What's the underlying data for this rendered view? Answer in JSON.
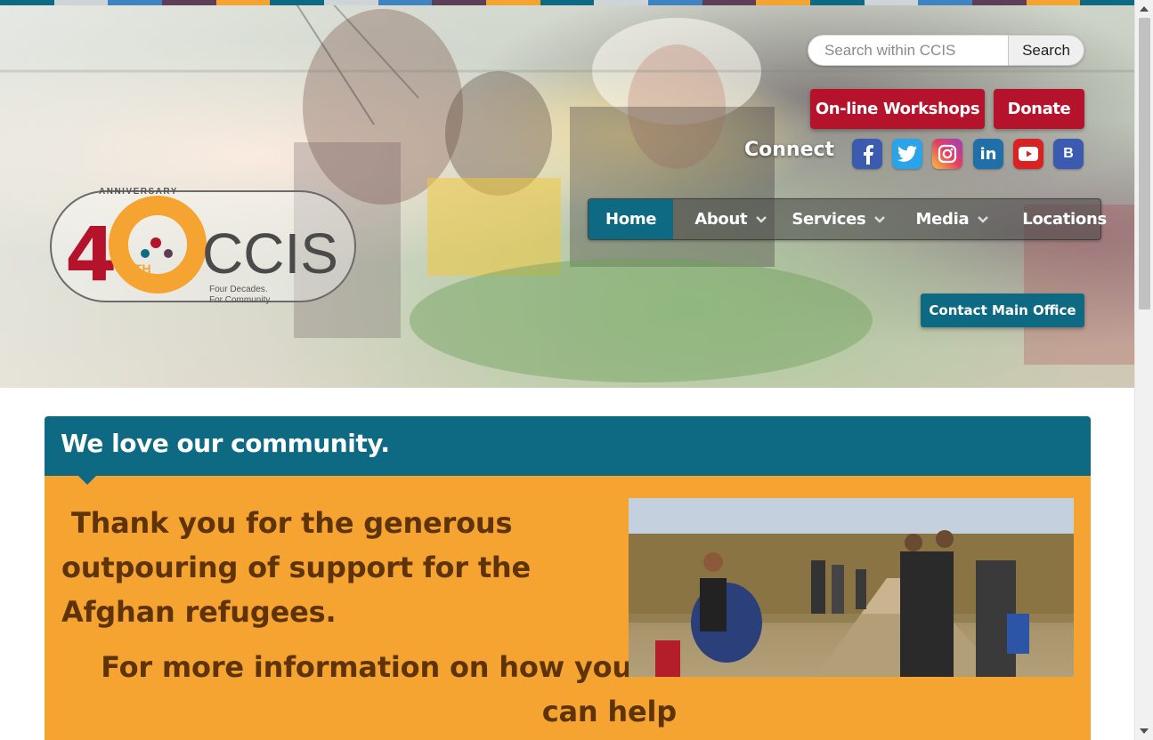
{
  "stripe_colors": [
    "#0e6a82",
    "#cfd4d6",
    "#3f83c0",
    "#5c3f57",
    "#f6a431",
    "#0e6a82",
    "#cfd4d6",
    "#3f83c0",
    "#5c3f57",
    "#f6a431",
    "#0e6a82",
    "#cfd4d6",
    "#3f83c0",
    "#5c3f57",
    "#f6a431",
    "#0e6a82",
    "#cfd4d6",
    "#3f83c0",
    "#5c3f57",
    "#f6a431",
    "#0e6a82"
  ],
  "search": {
    "placeholder": "Search within CCIS",
    "button_label": "Search"
  },
  "header_buttons": {
    "workshops_label": "On-line Workshops",
    "donate_label": "Donate"
  },
  "connect": {
    "label": "Connect",
    "icons": [
      "facebook-icon",
      "twitter-icon",
      "instagram-icon",
      "linkedin-icon",
      "youtube-icon",
      "blog-icon"
    ],
    "linkedin_glyph": "in",
    "blog_glyph": "B"
  },
  "nav": {
    "items": [
      {
        "label": "Home",
        "active": true,
        "has_dropdown": false
      },
      {
        "label": "About",
        "active": false,
        "has_dropdown": true
      },
      {
        "label": "Services",
        "active": false,
        "has_dropdown": true
      },
      {
        "label": "Media",
        "active": false,
        "has_dropdown": true
      },
      {
        "label": "Locations",
        "active": false,
        "has_dropdown": false
      }
    ]
  },
  "contact_button_label": "Contact Main Office",
  "logo": {
    "anniversary": "ANNIVERSARY",
    "number": "40",
    "suffix": "TH",
    "name": "CCIS",
    "tagline_1": "Four Decades.",
    "tagline_2": "For Community."
  },
  "panel": {
    "title": "We love our community.",
    "thanks_text": " Thank you for the generous outpouring of support for the Afghan refugees.",
    "more_line_1": "For more information on how you",
    "more_line_2": "can help"
  },
  "colors": {
    "teal": "#0e6a82",
    "red": "#b5132c",
    "orange": "#f6a431",
    "brown_text": "#5f3308"
  }
}
